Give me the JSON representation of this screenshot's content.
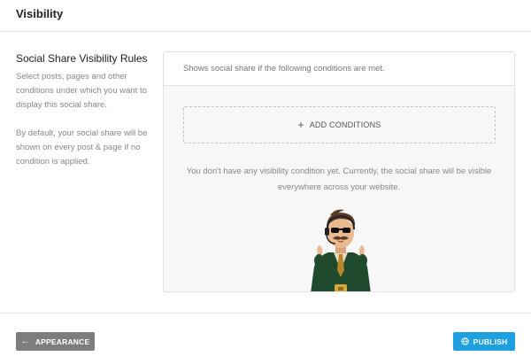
{
  "header": {
    "title": "Visibility"
  },
  "sidebar": {
    "title": "Social Share Visibility Rules",
    "description": "Select posts, pages and other conditions under which you want to display this social share.",
    "note": "By default, your social share will be shown on every post & page if no condition is applied."
  },
  "panel": {
    "header_text": "Shows social share if the following conditions are met.",
    "add_label": "ADD CONDITIONS",
    "empty_message": "You don't have any visibility condition yet. Currently, the social share will be visible everywhere across your website."
  },
  "footer": {
    "back_label": "APPEARANCE",
    "publish_label": "PUBLISH"
  },
  "icons": {
    "add": "plus-icon",
    "back": "arrow-left-icon",
    "publish": "globe-icon",
    "illustration": "mascot-illustration"
  },
  "colors": {
    "publish": "#1d9fe0",
    "back": "#7d7d7d"
  }
}
